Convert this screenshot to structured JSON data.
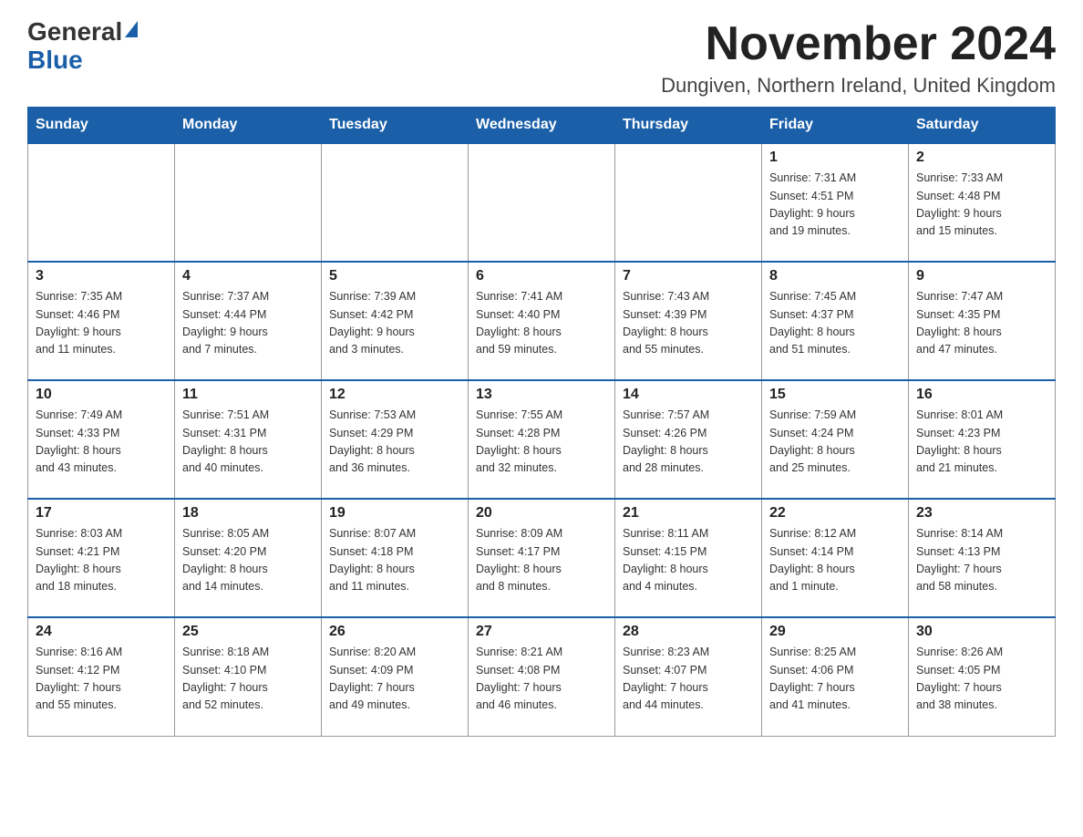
{
  "header": {
    "logo_general": "General",
    "logo_blue": "Blue",
    "month": "November 2024",
    "location": "Dungiven, Northern Ireland, United Kingdom"
  },
  "weekdays": [
    "Sunday",
    "Monday",
    "Tuesday",
    "Wednesday",
    "Thursday",
    "Friday",
    "Saturday"
  ],
  "weeks": [
    {
      "days": [
        {
          "num": "",
          "info": ""
        },
        {
          "num": "",
          "info": ""
        },
        {
          "num": "",
          "info": ""
        },
        {
          "num": "",
          "info": ""
        },
        {
          "num": "",
          "info": ""
        },
        {
          "num": "1",
          "info": "Sunrise: 7:31 AM\nSunset: 4:51 PM\nDaylight: 9 hours\nand 19 minutes."
        },
        {
          "num": "2",
          "info": "Sunrise: 7:33 AM\nSunset: 4:48 PM\nDaylight: 9 hours\nand 15 minutes."
        }
      ]
    },
    {
      "days": [
        {
          "num": "3",
          "info": "Sunrise: 7:35 AM\nSunset: 4:46 PM\nDaylight: 9 hours\nand 11 minutes."
        },
        {
          "num": "4",
          "info": "Sunrise: 7:37 AM\nSunset: 4:44 PM\nDaylight: 9 hours\nand 7 minutes."
        },
        {
          "num": "5",
          "info": "Sunrise: 7:39 AM\nSunset: 4:42 PM\nDaylight: 9 hours\nand 3 minutes."
        },
        {
          "num": "6",
          "info": "Sunrise: 7:41 AM\nSunset: 4:40 PM\nDaylight: 8 hours\nand 59 minutes."
        },
        {
          "num": "7",
          "info": "Sunrise: 7:43 AM\nSunset: 4:39 PM\nDaylight: 8 hours\nand 55 minutes."
        },
        {
          "num": "8",
          "info": "Sunrise: 7:45 AM\nSunset: 4:37 PM\nDaylight: 8 hours\nand 51 minutes."
        },
        {
          "num": "9",
          "info": "Sunrise: 7:47 AM\nSunset: 4:35 PM\nDaylight: 8 hours\nand 47 minutes."
        }
      ]
    },
    {
      "days": [
        {
          "num": "10",
          "info": "Sunrise: 7:49 AM\nSunset: 4:33 PM\nDaylight: 8 hours\nand 43 minutes."
        },
        {
          "num": "11",
          "info": "Sunrise: 7:51 AM\nSunset: 4:31 PM\nDaylight: 8 hours\nand 40 minutes."
        },
        {
          "num": "12",
          "info": "Sunrise: 7:53 AM\nSunset: 4:29 PM\nDaylight: 8 hours\nand 36 minutes."
        },
        {
          "num": "13",
          "info": "Sunrise: 7:55 AM\nSunset: 4:28 PM\nDaylight: 8 hours\nand 32 minutes."
        },
        {
          "num": "14",
          "info": "Sunrise: 7:57 AM\nSunset: 4:26 PM\nDaylight: 8 hours\nand 28 minutes."
        },
        {
          "num": "15",
          "info": "Sunrise: 7:59 AM\nSunset: 4:24 PM\nDaylight: 8 hours\nand 25 minutes."
        },
        {
          "num": "16",
          "info": "Sunrise: 8:01 AM\nSunset: 4:23 PM\nDaylight: 8 hours\nand 21 minutes."
        }
      ]
    },
    {
      "days": [
        {
          "num": "17",
          "info": "Sunrise: 8:03 AM\nSunset: 4:21 PM\nDaylight: 8 hours\nand 18 minutes."
        },
        {
          "num": "18",
          "info": "Sunrise: 8:05 AM\nSunset: 4:20 PM\nDaylight: 8 hours\nand 14 minutes."
        },
        {
          "num": "19",
          "info": "Sunrise: 8:07 AM\nSunset: 4:18 PM\nDaylight: 8 hours\nand 11 minutes."
        },
        {
          "num": "20",
          "info": "Sunrise: 8:09 AM\nSunset: 4:17 PM\nDaylight: 8 hours\nand 8 minutes."
        },
        {
          "num": "21",
          "info": "Sunrise: 8:11 AM\nSunset: 4:15 PM\nDaylight: 8 hours\nand 4 minutes."
        },
        {
          "num": "22",
          "info": "Sunrise: 8:12 AM\nSunset: 4:14 PM\nDaylight: 8 hours\nand 1 minute."
        },
        {
          "num": "23",
          "info": "Sunrise: 8:14 AM\nSunset: 4:13 PM\nDaylight: 7 hours\nand 58 minutes."
        }
      ]
    },
    {
      "days": [
        {
          "num": "24",
          "info": "Sunrise: 8:16 AM\nSunset: 4:12 PM\nDaylight: 7 hours\nand 55 minutes."
        },
        {
          "num": "25",
          "info": "Sunrise: 8:18 AM\nSunset: 4:10 PM\nDaylight: 7 hours\nand 52 minutes."
        },
        {
          "num": "26",
          "info": "Sunrise: 8:20 AM\nSunset: 4:09 PM\nDaylight: 7 hours\nand 49 minutes."
        },
        {
          "num": "27",
          "info": "Sunrise: 8:21 AM\nSunset: 4:08 PM\nDaylight: 7 hours\nand 46 minutes."
        },
        {
          "num": "28",
          "info": "Sunrise: 8:23 AM\nSunset: 4:07 PM\nDaylight: 7 hours\nand 44 minutes."
        },
        {
          "num": "29",
          "info": "Sunrise: 8:25 AM\nSunset: 4:06 PM\nDaylight: 7 hours\nand 41 minutes."
        },
        {
          "num": "30",
          "info": "Sunrise: 8:26 AM\nSunset: 4:05 PM\nDaylight: 7 hours\nand 38 minutes."
        }
      ]
    }
  ]
}
